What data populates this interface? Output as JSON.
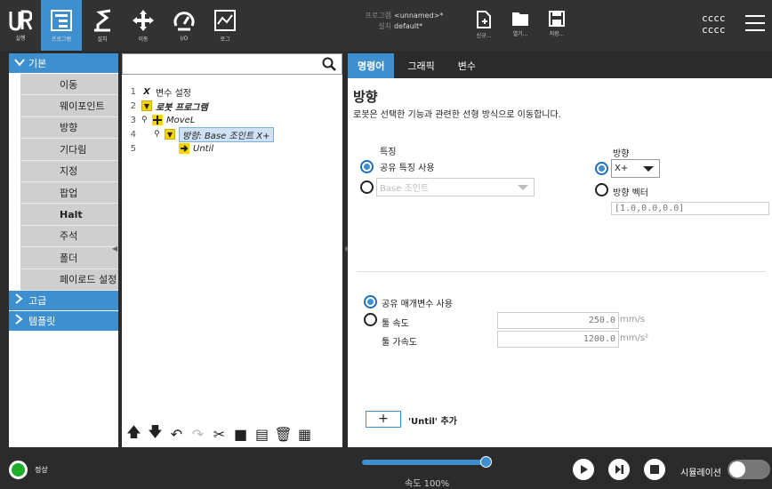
{
  "nav": {
    "items": [
      {
        "label": "프로그램"
      },
      {
        "label": "설치"
      },
      {
        "label": "이동"
      },
      {
        "label": "I/O"
      },
      {
        "label": "로그"
      }
    ],
    "logo_label": "실행"
  },
  "program": {
    "program_key": "프로그램",
    "program_value": "<unnamed>*",
    "install_key": "설치",
    "install_value": "default*"
  },
  "file_buttons": {
    "new": "신규...",
    "open": "열기...",
    "save": "저장..."
  },
  "user": {
    "line1": "cccc",
    "line2": "cccc"
  },
  "left": {
    "basic_label": "기본",
    "items": [
      "이동",
      "웨이포인트",
      "방향",
      "기다림",
      "지정",
      "팝업",
      "Halt",
      "주석",
      "폴더",
      "페이로드 설정"
    ],
    "advanced_label": "고급",
    "templates_label": "템플릿"
  },
  "tree": {
    "search_placeholder": "",
    "lines": [
      {
        "num": "1",
        "text": "변수 설정"
      },
      {
        "num": "2",
        "text": "로봇 프로그램"
      },
      {
        "num": "3",
        "text": "MoveL"
      },
      {
        "num": "4",
        "text": "방향: Base 조인트 X+"
      },
      {
        "num": "5",
        "text": "Until"
      }
    ]
  },
  "tabs": [
    "명령어",
    "그래픽",
    "변수"
  ],
  "command": {
    "title": "방향",
    "description": "로봇은 선택한 기능과 관련한 선형 방식으로 이동합니다.",
    "feature_label": "특징",
    "shared_feature": "공유 특징 사용",
    "feature_dropdown": "Base 조인트",
    "direction_label": "방향",
    "direction_value": "X+",
    "direction_vector": "방향 벡터",
    "vector_value": "[1.0,0.0,0.0]",
    "shared_params": "공유 매개변수 사용",
    "tool_speed_label": "툴 속도",
    "tool_speed": "250.0",
    "tool_speed_unit": "mm/s",
    "tool_accel_label": "툴 가속도",
    "tool_accel": "1200.0",
    "tool_accel_unit": "mm/s²",
    "add_until_symbol": "+",
    "add_until_label": "'Until' 추가"
  },
  "bottom": {
    "status": "정상",
    "speed_text": "속도 100%",
    "speed_fraction": 1.0,
    "simulation": "시뮬레이션"
  }
}
